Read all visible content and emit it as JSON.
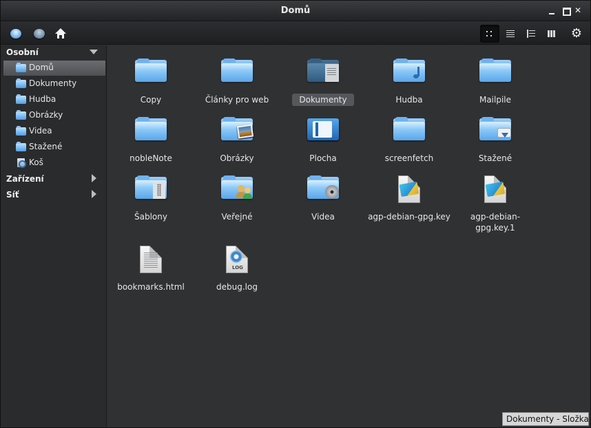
{
  "window": {
    "title": "Domů"
  },
  "toolbar": {
    "back_icon": "back-arrow-icon",
    "forward_icon": "forward-arrow-icon",
    "home_icon": "home-icon",
    "views": [
      "icon-view",
      "compact-view",
      "list-view",
      "column-view"
    ],
    "active_view": "icon-view"
  },
  "sidebar": {
    "sections": {
      "personal": "Osobní",
      "devices": "Zařízení",
      "network": "Síť"
    },
    "items": [
      {
        "label": "Domů",
        "icon": "home-folder-icon",
        "selected": true
      },
      {
        "label": "Dokumenty",
        "icon": "documents-folder-icon"
      },
      {
        "label": "Hudba",
        "icon": "music-folder-icon"
      },
      {
        "label": "Obrázky",
        "icon": "pictures-folder-icon"
      },
      {
        "label": "Videa",
        "icon": "videos-folder-icon"
      },
      {
        "label": "Stažené",
        "icon": "downloads-folder-icon"
      },
      {
        "label": "Koš",
        "icon": "trash-icon"
      }
    ]
  },
  "files": [
    {
      "name": "Copy",
      "type": "folder"
    },
    {
      "name": "Články pro web",
      "type": "folder"
    },
    {
      "name": "Dokumenty",
      "type": "folder-documents",
      "selected": true
    },
    {
      "name": "Hudba",
      "type": "folder-music"
    },
    {
      "name": "Mailpile",
      "type": "folder"
    },
    {
      "name": "nobleNote",
      "type": "folder"
    },
    {
      "name": "Obrázky",
      "type": "folder-pictures"
    },
    {
      "name": "Plocha",
      "type": "folder-desktop"
    },
    {
      "name": "screenfetch",
      "type": "folder"
    },
    {
      "name": "Stažené",
      "type": "folder-downloads"
    },
    {
      "name": "Šablony",
      "type": "folder-templates"
    },
    {
      "name": "Veřejné",
      "type": "folder-public"
    },
    {
      "name": "Videa",
      "type": "folder-videos"
    },
    {
      "name": "agp-debian-gpg.key",
      "type": "key-file"
    },
    {
      "name": "agp-debian-gpg.key.1",
      "type": "key-file",
      "label_lines": [
        "agp-debian-",
        "gpg.key.1"
      ]
    },
    {
      "name": "bookmarks.html",
      "type": "html-file"
    },
    {
      "name": "debug.log",
      "type": "log-file",
      "tag": "LOG"
    }
  ],
  "status": {
    "text": "Dokumenty - Složka"
  }
}
